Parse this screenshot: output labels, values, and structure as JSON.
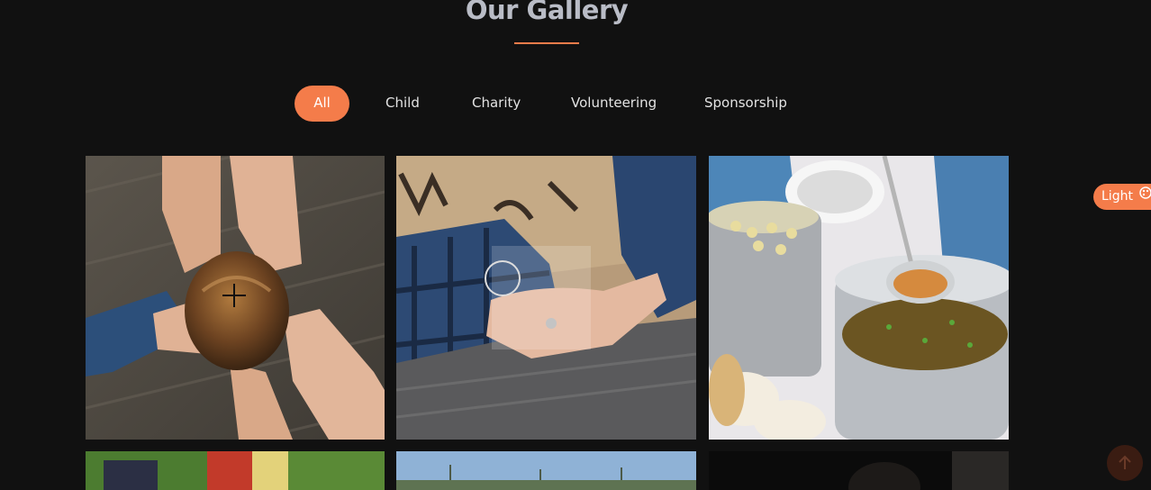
{
  "section": {
    "title": "Our Gallery"
  },
  "filters": [
    {
      "label": "All",
      "active": true
    },
    {
      "label": "Child",
      "active": false
    },
    {
      "label": "Charity",
      "active": false
    },
    {
      "label": "Volunteering",
      "active": false
    },
    {
      "label": "Sponsorship",
      "active": false
    }
  ],
  "gallery": [
    {
      "subject": "hands-sharing-bread-photo"
    },
    {
      "subject": "hands-holding-coins-photo"
    },
    {
      "subject": "soup-pots-photo"
    },
    {
      "subject": "outdoor-gathering-photo"
    },
    {
      "subject": "trees-sky-photo"
    },
    {
      "subject": "child-portrait-photo"
    }
  ],
  "theme_toggle": {
    "label": "Light",
    "icon": "palette-icon"
  },
  "scroll_top": {
    "icon": "arrow-up-icon"
  },
  "colors": {
    "accent": "#f47c4a",
    "background": "#111111",
    "title": "#b9bcc6"
  }
}
